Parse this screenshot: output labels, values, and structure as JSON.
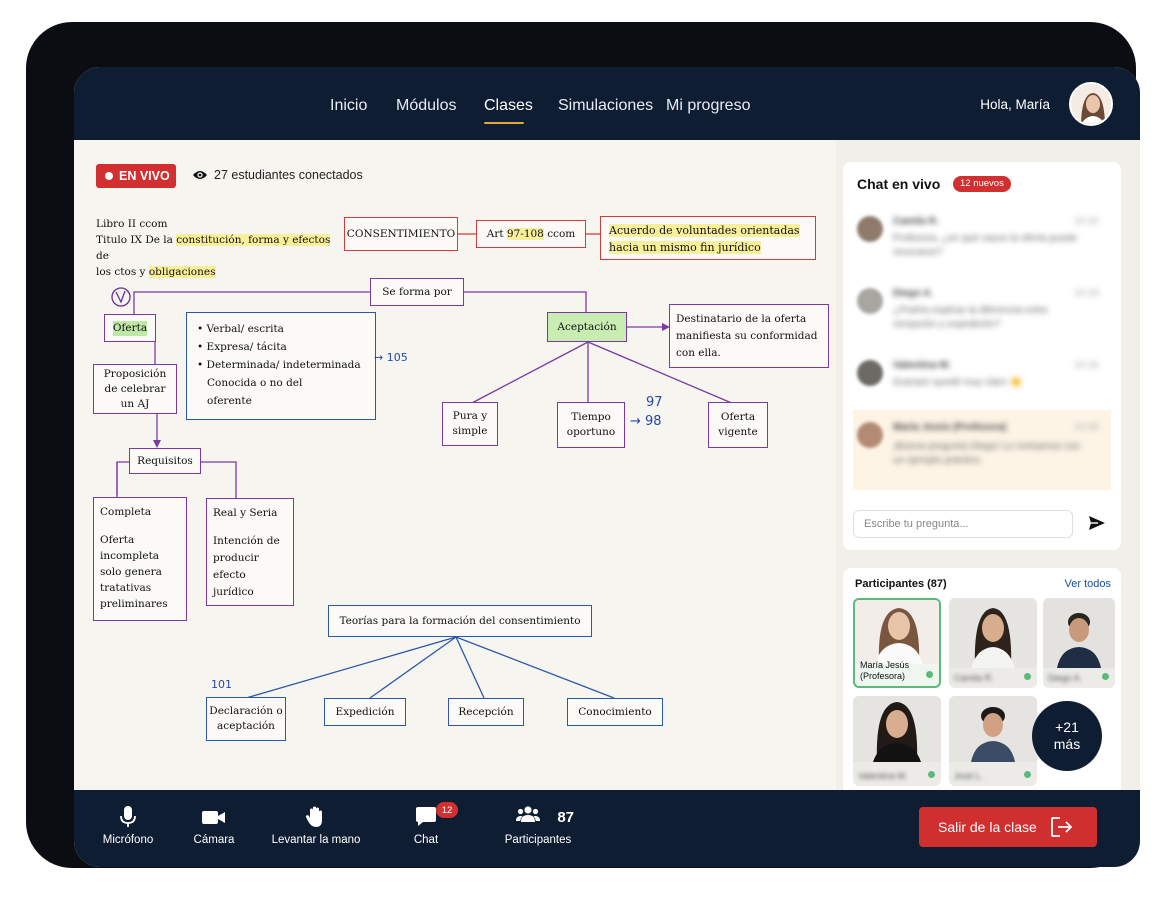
{
  "nav": {
    "items": [
      "Inicio",
      "Módulos",
      "Clases",
      "Simulaciones",
      "Mi progreso"
    ],
    "active": "Clases",
    "greeting": "Hola, María"
  },
  "board": {
    "live_label": "EN VIVO",
    "connected_text": "27 estudiantes conectados",
    "notes": {
      "line1": "Libro II ccom",
      "line2_a": "Titulo IX De la ",
      "line2_hl": "constitución, forma y efectos",
      "line2_b": " de",
      "line3_a": "los ctos y ",
      "line3_hl": "obligaciones"
    },
    "consentimiento": "CONSENTIMIENTO",
    "art_a": "Art ",
    "art_hl": "97-108",
    "art_b": " ccom",
    "acuerdo_hl1": "Acuerdo de voluntades orientadas",
    "acuerdo_hl2": "hacia un mismo fin jurídico",
    "se_forma_por": "Se forma por",
    "oferta": "Oferta",
    "aceptacion": "Aceptación",
    "bullets": [
      "Verbal/ escrita",
      "Expresa/ tácita",
      "Determinada/ indeterminada"
    ],
    "bullets_extra1": "Conocida o no del",
    "bullets_extra2": "oferente",
    "proposicion": "Proposición de celebrar un AJ",
    "requisitos": "Requisitos",
    "completa_title": "Completa",
    "completa_body": "Oferta incompleta solo genera tratativas preliminares",
    "real_title": "Real y Seria",
    "real_body": "Intención de producir efecto jurídico",
    "destinatario": "Destinatario de la oferta manifiesta su conformidad con ella.",
    "pura": "Pura y simple",
    "tiempo": "Tiempo oportuno",
    "oferta_vigente": "Oferta vigente",
    "teorias": "Teorías para la formación del consentimiento",
    "declaracion": "Declaración o aceptación",
    "expedicion": "Expedición",
    "recepcion": "Recepción",
    "conocimiento": "Conocimiento",
    "hand_105": "→ 105",
    "hand_97": "97",
    "hand_98": "→ 98",
    "hand_101": "101"
  },
  "chat": {
    "title": "Chat en vivo",
    "new_badge": "12 nuevos",
    "messages": [
      {
        "name": "Camila R.",
        "time": "10:32",
        "text": "Profesora, ¿en qué casos la oferta puede revocarse?"
      },
      {
        "name": "Diego A.",
        "time": "10:33",
        "text": "¿Podría explicar la diferencia entre recepción y expedición?"
      },
      {
        "name": "Valentina M.",
        "time": "10:34",
        "text": "Gracias! quedó muy claro 👏"
      },
      {
        "name": "María Jesús (Profesora)",
        "time": "10:35",
        "text": "¡Buena pregunta Diego! Lo revisamos con un ejemplo práctico."
      }
    ],
    "input_placeholder": "Escribe tu pregunta..."
  },
  "participants": {
    "title": "Participantes (87)",
    "see_all": "Ver todos",
    "host_name": "María Jesús",
    "host_role": "(Profesora)",
    "others": [
      "Camila R.",
      "Diego A.",
      "Valentina M.",
      "José L."
    ],
    "more_count": "+21",
    "more_label": "más"
  },
  "controls": {
    "mic": "Micrófono",
    "camera": "Cámara",
    "hand": "Levantar la mano",
    "chat": "Chat",
    "chat_badge": "12",
    "participants_count": "87",
    "participants": "Participantes",
    "exit": "Salir de la clase"
  },
  "colors": {
    "navy": "#0f1d33",
    "accent_red": "#d23030",
    "underline": "#e5a43b",
    "online": "#5bb97a"
  }
}
